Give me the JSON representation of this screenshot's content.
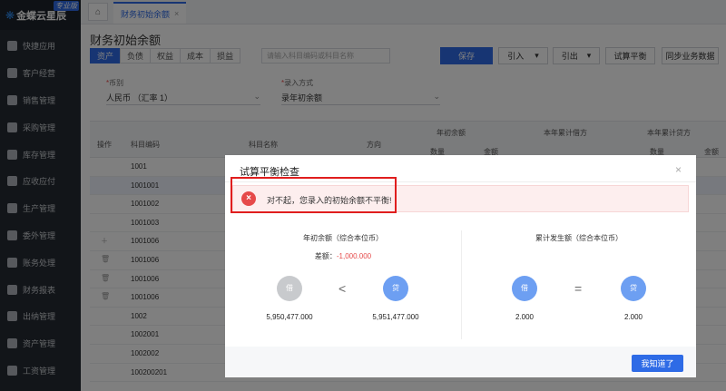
{
  "app": {
    "name": "金蝶云星辰",
    "badge": "专业版"
  },
  "sidebar": {
    "items": [
      {
        "label": "快捷应用"
      },
      {
        "label": "客户经营"
      },
      {
        "label": "销售管理"
      },
      {
        "label": "采购管理"
      },
      {
        "label": "库存管理"
      },
      {
        "label": "应收应付"
      },
      {
        "label": "生产管理"
      },
      {
        "label": "委外管理"
      },
      {
        "label": "账务处理"
      },
      {
        "label": "财务报表"
      },
      {
        "label": "出纳管理"
      },
      {
        "label": "资产管理"
      },
      {
        "label": "工资管理"
      }
    ]
  },
  "tabs": [
    {
      "label": "财务初始余额"
    }
  ],
  "page": {
    "title": "财务初始余额",
    "categories": [
      "资产",
      "负债",
      "权益",
      "成本",
      "损益"
    ],
    "search_placeholder": "请输入科目编码或科目名称",
    "buttons": {
      "save": "保存",
      "import": "引入",
      "export": "引出",
      "trial": "试算平衡",
      "sync": "同步业务数据"
    },
    "currency_label": "币别",
    "currency_value": "人民币 （汇率 1）",
    "mode_label": "录入方式",
    "mode_value": "录年初余额"
  },
  "grid": {
    "headers": {
      "op": "操作",
      "code": "科目编码",
      "name": "科目名称",
      "dir": "方向",
      "g1": "年初余额",
      "g2": "本年累计借方",
      "g3": "本年累计贷方",
      "qty": "数量",
      "amt": "金额"
    },
    "rows": [
      {
        "code": "1001"
      },
      {
        "code": "1001001"
      },
      {
        "code": "1001002"
      },
      {
        "code": "1001003"
      },
      {
        "code": "1001006"
      },
      {
        "code": "1001006"
      },
      {
        "code": "1001006"
      },
      {
        "code": "1001006"
      },
      {
        "code": "1002"
      },
      {
        "code": "1002001"
      },
      {
        "code": "1002002"
      },
      {
        "code": "100200201"
      }
    ]
  },
  "modal": {
    "title": "试算平衡检查",
    "error_text": "对不起，您录入的初始余额不平衡!",
    "left_title": "年初余额（综合本位币）",
    "diff_label": "差额：",
    "diff_value": "-1,000.000",
    "left_debit_label": "借",
    "left_credit_label": "贷",
    "left_symbol": "<",
    "left_debit_amount": "5,950,477.000",
    "left_credit_amount": "5,951,477.000",
    "right_title": "累计发生额（综合本位币）",
    "right_debit_label": "借",
    "right_credit_label": "贷",
    "right_symbol": "=",
    "right_debit_amount": "2.000",
    "right_credit_amount": "2.000",
    "ok_label": "我知道了"
  }
}
